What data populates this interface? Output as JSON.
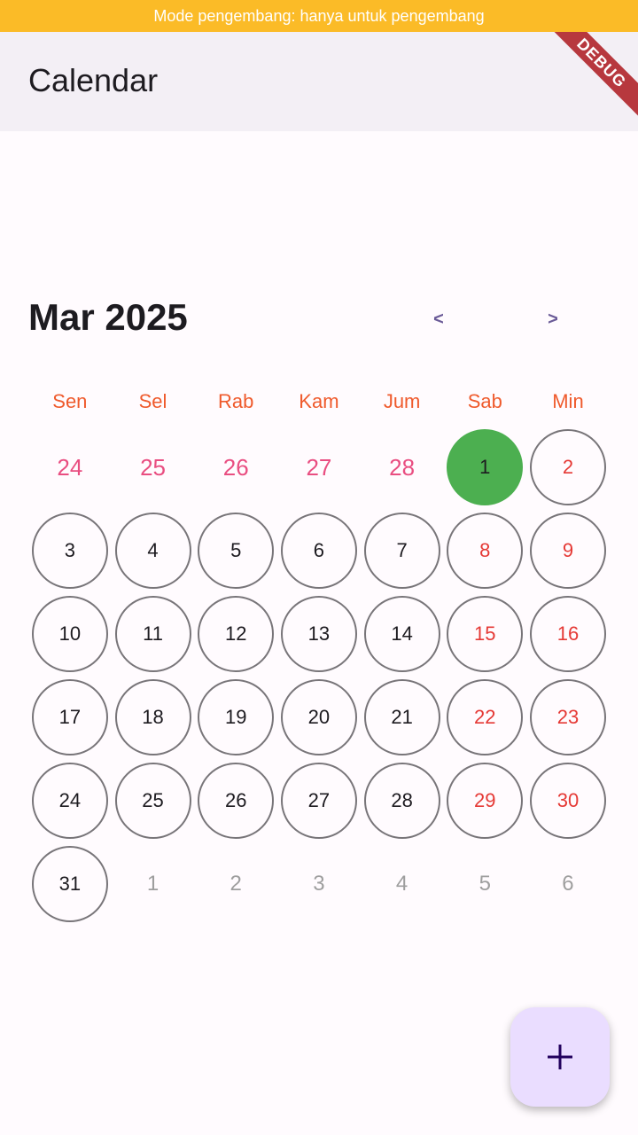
{
  "system": {
    "dev_banner": "Mode pengembang: hanya untuk pengembang",
    "debug_ribbon": "DEBUG"
  },
  "app_bar": {
    "title": "Calendar"
  },
  "calendar": {
    "month_label": "Mar 2025",
    "prev_label": "<",
    "next_label": ">",
    "weekdays": [
      "Sen",
      "Sel",
      "Rab",
      "Kam",
      "Jum",
      "Sab",
      "Min"
    ],
    "selected_day": "1",
    "days": [
      {
        "label": "24",
        "kind": "prev"
      },
      {
        "label": "25",
        "kind": "prev"
      },
      {
        "label": "26",
        "kind": "prev"
      },
      {
        "label": "27",
        "kind": "prev"
      },
      {
        "label": "28",
        "kind": "prev"
      },
      {
        "label": "1",
        "kind": "selected"
      },
      {
        "label": "2",
        "kind": "weekend"
      },
      {
        "label": "3",
        "kind": "weekday"
      },
      {
        "label": "4",
        "kind": "weekday"
      },
      {
        "label": "5",
        "kind": "weekday"
      },
      {
        "label": "6",
        "kind": "weekday"
      },
      {
        "label": "7",
        "kind": "weekday"
      },
      {
        "label": "8",
        "kind": "weekend"
      },
      {
        "label": "9",
        "kind": "weekend"
      },
      {
        "label": "10",
        "kind": "weekday"
      },
      {
        "label": "11",
        "kind": "weekday"
      },
      {
        "label": "12",
        "kind": "weekday"
      },
      {
        "label": "13",
        "kind": "weekday"
      },
      {
        "label": "14",
        "kind": "weekday"
      },
      {
        "label": "15",
        "kind": "weekend"
      },
      {
        "label": "16",
        "kind": "weekend"
      },
      {
        "label": "17",
        "kind": "weekday"
      },
      {
        "label": "18",
        "kind": "weekday"
      },
      {
        "label": "19",
        "kind": "weekday"
      },
      {
        "label": "20",
        "kind": "weekday"
      },
      {
        "label": "21",
        "kind": "weekday"
      },
      {
        "label": "22",
        "kind": "weekend"
      },
      {
        "label": "23",
        "kind": "weekend"
      },
      {
        "label": "24",
        "kind": "weekday"
      },
      {
        "label": "25",
        "kind": "weekday"
      },
      {
        "label": "26",
        "kind": "weekday"
      },
      {
        "label": "27",
        "kind": "weekday"
      },
      {
        "label": "28",
        "kind": "weekday"
      },
      {
        "label": "29",
        "kind": "weekend"
      },
      {
        "label": "30",
        "kind": "weekend"
      },
      {
        "label": "31",
        "kind": "weekday"
      },
      {
        "label": "1",
        "kind": "next"
      },
      {
        "label": "2",
        "kind": "next"
      },
      {
        "label": "3",
        "kind": "next"
      },
      {
        "label": "4",
        "kind": "next"
      },
      {
        "label": "5",
        "kind": "next"
      },
      {
        "label": "6",
        "kind": "next"
      }
    ]
  },
  "fab": {
    "icon": "plus-icon"
  },
  "colors": {
    "selected": "#4caf50",
    "weekend": "#e53935",
    "weekday_header": "#ef5a2c",
    "prev_month": "#e94e81",
    "next_month": "#9e9e9e",
    "fab_bg": "#eaddff",
    "banner": "#fbbb27"
  }
}
